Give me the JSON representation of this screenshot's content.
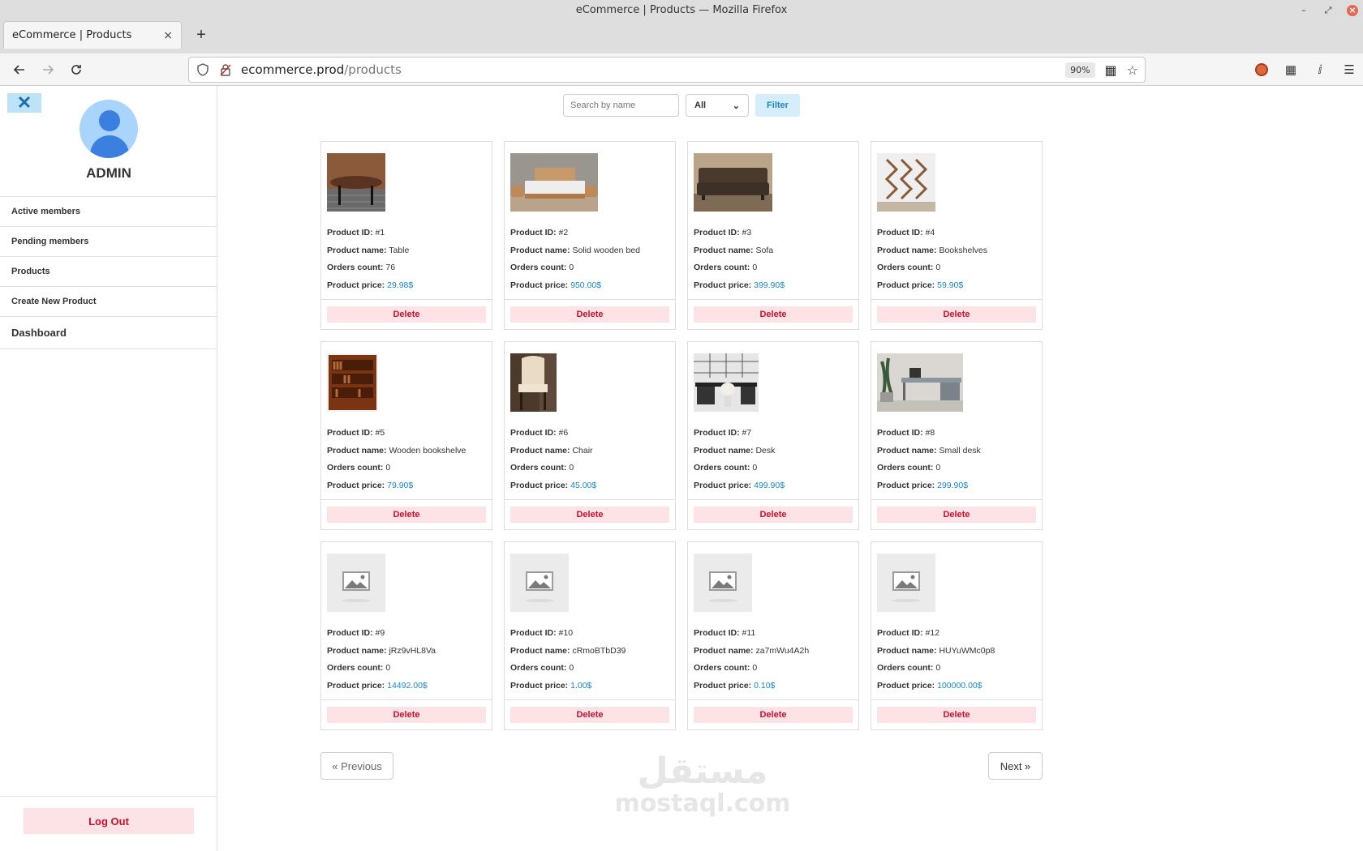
{
  "window": {
    "title": "eCommerce | Products — Mozilla Firefox"
  },
  "tab": {
    "title": "eCommerce | Products",
    "close": "×",
    "new": "+"
  },
  "url": {
    "host": "ecommerce.prod",
    "path": "/products",
    "zoom": "90%"
  },
  "sidebar": {
    "close_label": "✕",
    "admin_name": "ADMIN",
    "items": [
      {
        "label": "Active members"
      },
      {
        "label": "Pending members"
      },
      {
        "label": "Products"
      },
      {
        "label": "Create New Product"
      },
      {
        "label": "Dashboard"
      }
    ],
    "logout": "Log Out"
  },
  "filters": {
    "search_placeholder": "Search by name",
    "select_value": "All",
    "button": "Filter"
  },
  "labels": {
    "id": "Product ID:",
    "name": "Product name:",
    "orders": "Orders count:",
    "price": "Product price:",
    "delete": "Delete"
  },
  "products": [
    {
      "id": "#1",
      "name": "Table",
      "orders": "76",
      "price": "29.98$",
      "image": "table"
    },
    {
      "id": "#2",
      "name": "Solid wooden bed",
      "orders": "0",
      "price": "950.00$",
      "image": "bed"
    },
    {
      "id": "#3",
      "name": "Sofa",
      "orders": "0",
      "price": "399.90$",
      "image": "sofa"
    },
    {
      "id": "#4",
      "name": "Bookshelves",
      "orders": "0",
      "price": "59.90$",
      "image": "bookshelves"
    },
    {
      "id": "#5",
      "name": "Wooden bookshelve",
      "orders": "0",
      "price": "79.90$",
      "image": "wooden-bookshelf"
    },
    {
      "id": "#6",
      "name": "Chair",
      "orders": "0",
      "price": "45.00$",
      "image": "chair"
    },
    {
      "id": "#7",
      "name": "Desk",
      "orders": "0",
      "price": "499.90$",
      "image": "desk"
    },
    {
      "id": "#8",
      "name": "Small desk",
      "orders": "0",
      "price": "299.90$",
      "image": "small-desk"
    },
    {
      "id": "#9",
      "name": "jRz9vHL8Va",
      "orders": "0",
      "price": "14492.00$",
      "image": "placeholder"
    },
    {
      "id": "#10",
      "name": "cRmoBTbD39",
      "orders": "0",
      "price": "1.00$",
      "image": "placeholder"
    },
    {
      "id": "#11",
      "name": "za7mWu4A2h",
      "orders": "0",
      "price": "0.10$",
      "image": "placeholder"
    },
    {
      "id": "#12",
      "name": "HUYuWMc0p8",
      "orders": "0",
      "price": "100000.00$",
      "image": "placeholder"
    }
  ],
  "pagination": {
    "prev": "« Previous",
    "next": "Next »"
  },
  "watermark": {
    "arabic": "مستقل",
    "latin": "mostaql.com"
  }
}
